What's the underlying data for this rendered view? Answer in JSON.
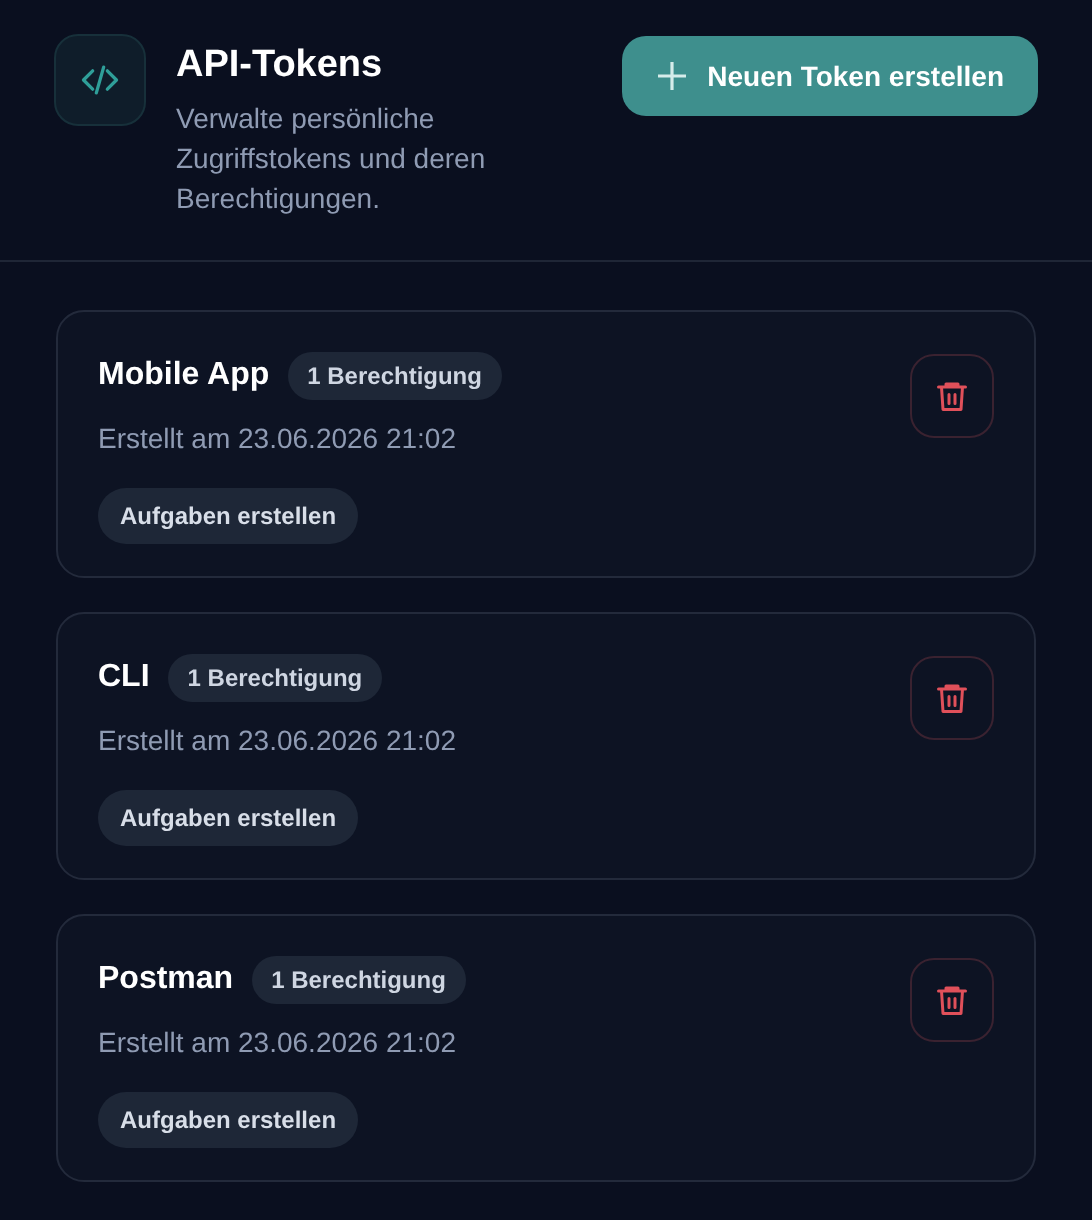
{
  "header": {
    "title": "API-Tokens",
    "description": "Verwalte persönliche Zugriffstokens und deren Berechtigungen.",
    "create_button": "Neuen Token erstellen"
  },
  "tokens": [
    {
      "name": "Mobile App",
      "permission_count": "1 Berechtigung",
      "created": "Erstellt am 23.06.2026 21:02",
      "permissions": [
        "Aufgaben erstellen"
      ]
    },
    {
      "name": "CLI",
      "permission_count": "1 Berechtigung",
      "created": "Erstellt am 23.06.2026 21:02",
      "permissions": [
        "Aufgaben erstellen"
      ]
    },
    {
      "name": "Postman",
      "permission_count": "1 Berechtigung",
      "created": "Erstellt am 23.06.2026 21:02",
      "permissions": [
        "Aufgaben erstellen"
      ]
    }
  ]
}
